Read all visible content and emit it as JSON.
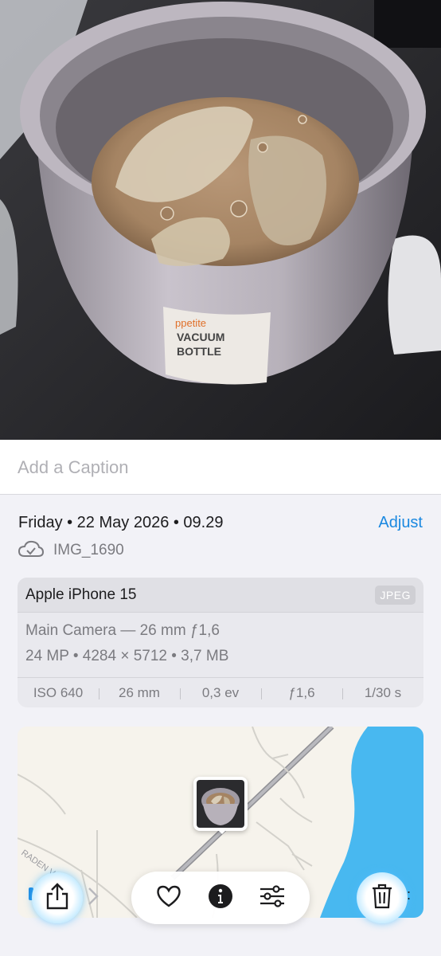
{
  "photo": {
    "description_icon": "photo-content",
    "bottle_label_lines": [
      "ppetite",
      "VACUUM",
      "BOTTLE"
    ]
  },
  "caption": {
    "placeholder": "Add a Caption"
  },
  "info": {
    "datetime": "Friday • 22 May 2026 • 09.29",
    "adjust_label": "Adjust",
    "filename": "IMG_1690",
    "cloud_icon": "cloud-check-icon"
  },
  "exif": {
    "device": "Apple iPhone 15",
    "format": "JPEG",
    "lens": "Main Camera — 26 mm ƒ1,6",
    "specs": "24 MP • 4284 × 5712 • 3,7 MB",
    "row": [
      "ISO 640",
      "26 mm",
      "0,3 ev",
      "ƒ1,6",
      "1/30 s"
    ]
  },
  "map": {
    "street_label": "RADEN V",
    "water_color": "#48b8f0",
    "land_color": "#f6f3ec"
  },
  "toolbar": {
    "share_icon": "share-icon",
    "favorite_icon": "heart-icon",
    "info_icon": "info-icon",
    "adjust_icon": "sliders-icon",
    "delete_icon": "trash-icon"
  },
  "colors": {
    "accent": "#1a88e0",
    "secondary_text": "#7b7b80"
  }
}
